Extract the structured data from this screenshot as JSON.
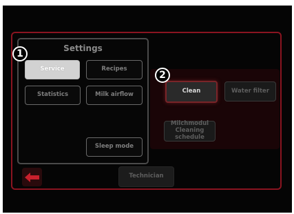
{
  "settings": {
    "title": "Settings",
    "buttons": {
      "service": "Service",
      "recipes": "Recipes",
      "statistics": "Statistics",
      "milk_airflow": "Milk airflow",
      "sleep_mode": "Sleep mode"
    }
  },
  "service_menu": {
    "clean": "Clean",
    "water_filter": "Water filter",
    "milchmodul_line1": "Milchmodul",
    "milchmodul_line2": "Cleaning schedule"
  },
  "footer": {
    "technician": "Technician",
    "back_icon": "back-arrow-icon"
  },
  "callouts": {
    "one": "1",
    "two": "2"
  },
  "colors": {
    "accent": "#8a1420",
    "back_arrow": "#c8202c"
  }
}
